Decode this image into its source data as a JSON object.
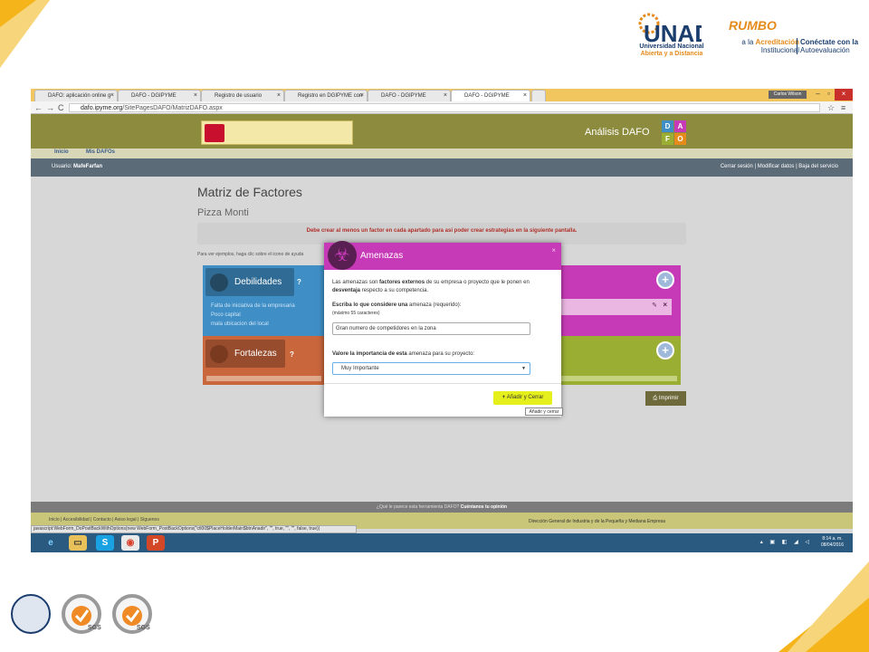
{
  "slide": {
    "unad_name": "UNAD",
    "unad_line1": "Universidad Nacional",
    "unad_line2": "Abierta y a Distancia",
    "rumbo": "RUMBO",
    "rumbo_line1": "a la",
    "rumbo_bold": "Acreditación",
    "rumbo_line2": "Institucional",
    "conect_line1": "Conéctate con la",
    "conect_line2": "Autoevaluación",
    "cert1_label": "SGS",
    "cert2_label": "SGS"
  },
  "browser": {
    "tabs": [
      {
        "label": "DAFO: aplicación online g"
      },
      {
        "label": "DAFO - DGIPYME"
      },
      {
        "label": "Registro de usuario"
      },
      {
        "label": "Registro en DGIPYME con"
      },
      {
        "label": "DAFO - DGIPYME"
      },
      {
        "label": "DAFO - DGIPYME"
      }
    ],
    "user_chip": "Carlos Wilson",
    "url_host": "dafo.ipyme.org",
    "url_path": "/SitePagesDAFO/MatrizDAFO.aspx"
  },
  "site": {
    "header_title": "Análisis DAFO",
    "dafo_letters": [
      "D",
      "A",
      "F",
      "O"
    ],
    "nav": [
      "Inicio",
      "Mis DAFOs"
    ],
    "user_label": "Usuario:",
    "user_name": "MafeFarfan",
    "user_links": "Cerrar sesión | Modificar datos | Baja del servicio",
    "page_title": "Matriz de Factores",
    "company": "Pizza Monti",
    "alert": "Debe crear al menos un factor en cada apartado para así poder crear estrategias en la siguiente pantalla.",
    "hint": "Para ver ejemplos, haga clic sobre el icono de ayuda",
    "quadrants": {
      "debilidades": {
        "title": "Debilidades",
        "items": [
          "Falta de iniciativa de la empresaria",
          "Poco capital",
          "mala ubicacion del local"
        ]
      },
      "fortalezas": {
        "title": "Fortalezas"
      }
    },
    "print_label": "Imprimir"
  },
  "modal": {
    "title": "Amenazas",
    "close": "×",
    "intro_1": "Las amenazas son ",
    "intro_b1": "factores externos",
    "intro_2": " de su empresa o proyecto que le ponen en ",
    "intro_b2": "desventaja",
    "intro_3": " respecto a su competencia.",
    "field_label_b": "Escriba lo que considere una",
    "field_label": " amenaza (requerido):",
    "field_hint": "(máximo 55 caracteres)",
    "field_value": "Gran numero de competidores en la zona",
    "select_label_b": "Valore la importancia de esta",
    "select_label": " amenaza para su proyecto:",
    "select_value": "Muy Importante",
    "add_button": "Añadir y Cerrar",
    "tooltip": "Añadir y cerrar"
  },
  "footer": {
    "feedback": "¿Qué le parece esta herramienta DAFO?",
    "feedback_link": "Cuéntanos tu opinión",
    "links": "Inicio | Accesibilidad | Contacto | Aviso legal | Síguenos",
    "org": "Dirección General de Industria y de la Pequeña y Mediana Empresa",
    "status": "javascript:WebForm_DoPostBackWithOptions(new WebForm_PostBackOptions(\"ctl00$PlaceHolderMain$btnAnadir\", \"\", true, \"\", \"\", false, true))"
  },
  "taskbar": {
    "time": "8:14 a. m.",
    "date": "08/04/2016"
  }
}
